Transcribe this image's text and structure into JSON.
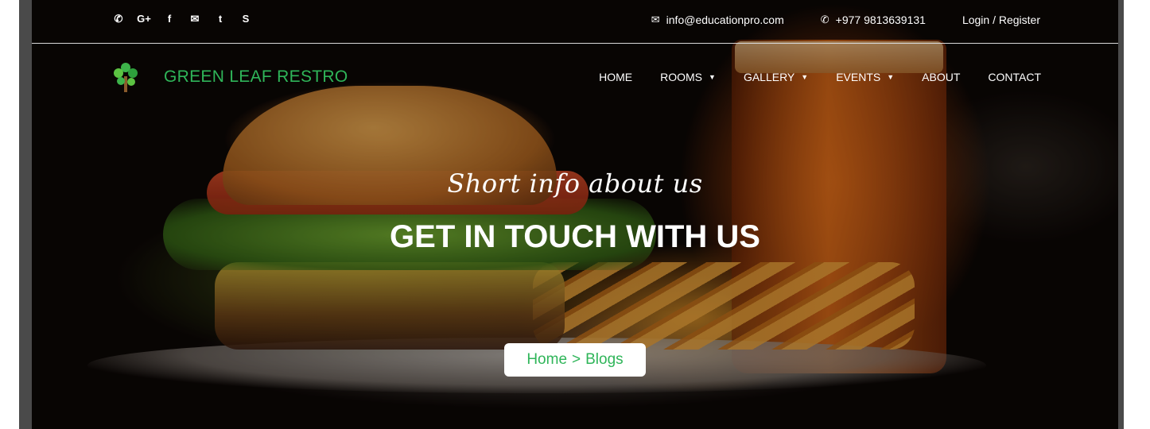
{
  "social_icons": [
    {
      "name": "viber-icon",
      "glyph": "✆"
    },
    {
      "name": "google-plus-icon",
      "glyph": "G+"
    },
    {
      "name": "facebook-icon",
      "glyph": "f"
    },
    {
      "name": "messenger-icon",
      "glyph": "✉"
    },
    {
      "name": "twitter-icon",
      "glyph": "t"
    },
    {
      "name": "skype-icon",
      "glyph": "S"
    }
  ],
  "contact": {
    "email_icon": "✉",
    "email": "info@educationpro.com",
    "phone_icon": "✆",
    "phone": "+977 9813639131",
    "login": "Login / Register"
  },
  "brand": {
    "name": "GREEN LEAF RESTRO"
  },
  "nav": {
    "home": "HOME",
    "rooms": "ROOMS",
    "gallery": "GALLERY",
    "events": "EVENTS",
    "about": "ABOUT",
    "contact": "CONTACT",
    "caret": "▼"
  },
  "hero": {
    "tagline": "Short info about us",
    "headline": "GET IN TOUCH WITH US"
  },
  "breadcrumb": {
    "home": "Home",
    "separator": ">",
    "current": "Blogs"
  },
  "colors": {
    "accent": "#2fb559"
  }
}
